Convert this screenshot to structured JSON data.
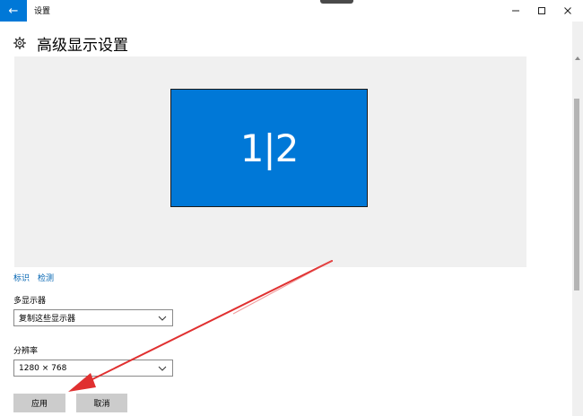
{
  "titlebar": {
    "back_label": "←",
    "app_title": "设置",
    "minimize_label": "—",
    "maximize_label": "☐",
    "close_label": "✕"
  },
  "page": {
    "title": "高级显示设置",
    "header_icon": "gear-icon"
  },
  "display_preview": {
    "monitor_label": "1|2",
    "monitor_color": "#0078d7",
    "background_color": "#f0f0f0"
  },
  "links": {
    "identify": "标识",
    "detect": "检测"
  },
  "multiple_displays": {
    "label": "多显示器",
    "value": "复制这些显示器"
  },
  "resolution": {
    "label": "分辨率",
    "value": "1280 × 768"
  },
  "buttons": {
    "apply": "应用",
    "cancel": "取消"
  },
  "annotation": {
    "type": "red-arrow",
    "color": "#e03030",
    "target": "apply-button"
  },
  "colors": {
    "accent": "#0078d7",
    "link": "#0063b1",
    "button_bg": "#cccccc"
  }
}
